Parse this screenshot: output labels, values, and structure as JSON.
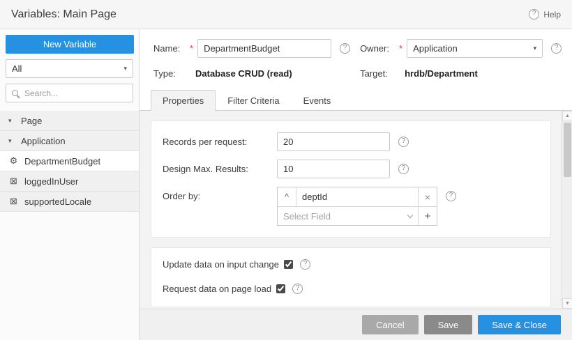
{
  "header": {
    "title": "Variables: Main Page",
    "help_label": "Help"
  },
  "colors": {
    "accent_blue": "#2591e0",
    "save_gray": "#8a8a8a",
    "cancel_gray": "#a9a9a9"
  },
  "icons": {
    "help_glyph": "?",
    "dropdown_arrow": "▾",
    "expander_down": "▾",
    "gear": "⚙",
    "variable_box": "⊠",
    "move_up": "^",
    "remove": "×",
    "add": "+",
    "scroll_up": "▲",
    "scroll_down": "▼"
  },
  "sidebar": {
    "new_variable_button": "New Variable",
    "filter_dropdown": {
      "value": "All"
    },
    "search": {
      "placeholder": "Search..."
    },
    "tree": [
      {
        "type": "group",
        "label": "Page"
      },
      {
        "type": "group",
        "label": "Application"
      },
      {
        "type": "item",
        "label": "DepartmentBudget",
        "selected": true
      },
      {
        "type": "item",
        "label": "loggedInUser",
        "selected": false
      },
      {
        "type": "item",
        "label": "supportedLocale",
        "selected": false
      }
    ]
  },
  "form": {
    "required_marker": "*",
    "name": {
      "label": "Name:",
      "value": "DepartmentBudget"
    },
    "owner": {
      "label": "Owner:",
      "value": "Application"
    },
    "type": {
      "label": "Type:",
      "value": "Database CRUD (read)"
    },
    "target": {
      "label": "Target:",
      "value": "hrdb/Department"
    }
  },
  "tabs": [
    {
      "label": "Properties",
      "active": true
    },
    {
      "label": "Filter Criteria",
      "active": false
    },
    {
      "label": "Events",
      "active": false
    }
  ],
  "properties": {
    "records_per_request": {
      "label": "Records per request:",
      "value": "20"
    },
    "design_max_results": {
      "label": "Design Max. Results:",
      "value": "10"
    },
    "order_by": {
      "label": "Order by:",
      "field_value": "deptId",
      "select_placeholder": "Select Field"
    },
    "update_on_input_change": {
      "label": "Update data on input change",
      "checked": true
    },
    "request_on_page_load": {
      "label": "Request data on page load",
      "checked": true
    }
  },
  "footer": {
    "cancel": "Cancel",
    "save": "Save",
    "save_and_close": "Save & Close"
  }
}
